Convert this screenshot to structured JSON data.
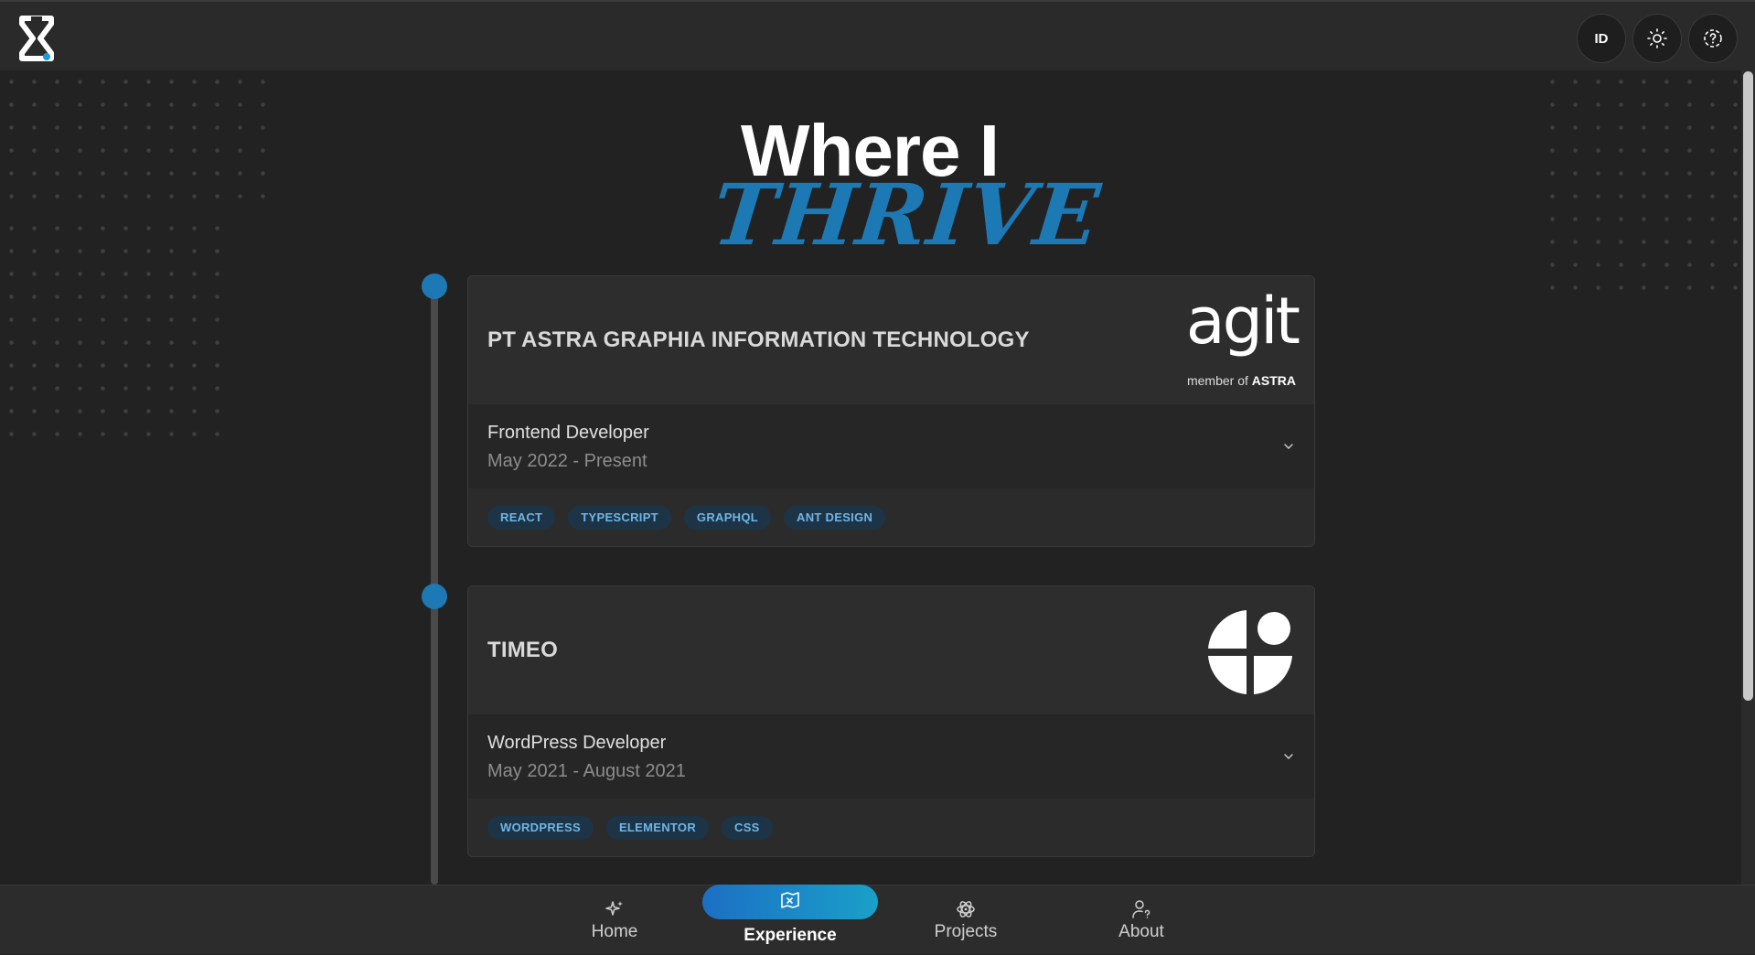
{
  "header": {
    "language_label": "ID",
    "icons": [
      "hourglass-logo",
      "sun-icon",
      "help-icon"
    ]
  },
  "hero": {
    "line1": "Where I",
    "line2": "THRIVE"
  },
  "experience": [
    {
      "company": "PT ASTRA GRAPHIA INFORMATION TECHNOLOGY",
      "logo_text": "agit",
      "logo_sub_prefix": "member of ",
      "logo_sub_brand": "ASTRA",
      "role": "Frontend Developer",
      "period": "May 2022 - Present",
      "tags": [
        "REACT",
        "TYPESCRIPT",
        "GRAPHQL",
        "ANT DESIGN"
      ]
    },
    {
      "company": "TIMEO",
      "role": "WordPress Developer",
      "period": "May 2021 - August 2021",
      "tags": [
        "WORDPRESS",
        "ELEMENTOR",
        "CSS"
      ]
    }
  ],
  "nav": {
    "home": "Home",
    "experience": "Experience",
    "projects": "Projects",
    "about": "About",
    "active": "experience"
  },
  "colors": {
    "accent": "#1d79b4",
    "background": "#222222",
    "tag_bg": "#1d3447",
    "tag_text": "#6fb6e6"
  }
}
